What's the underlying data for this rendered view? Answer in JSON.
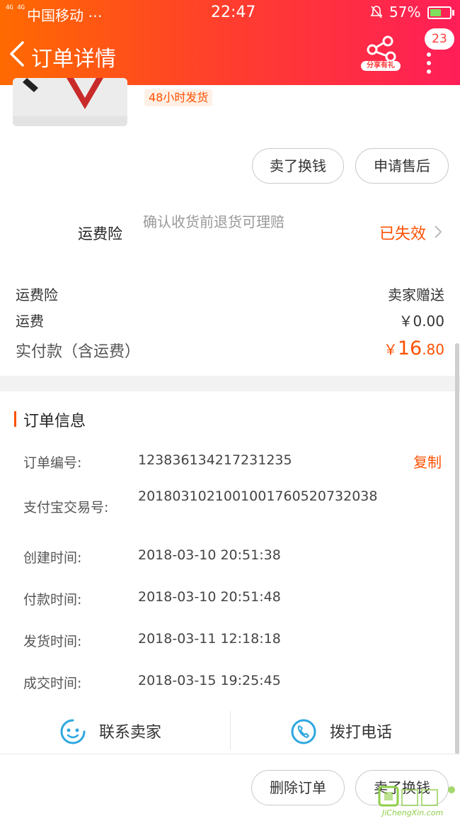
{
  "status_bar": {
    "network": "4G 4G",
    "carrier": "中国移动 ⋯",
    "time": "22:47",
    "battery": "57%",
    "battery_fill": 0.57
  },
  "header": {
    "title": "订单详情",
    "share_label": "分享有礼",
    "badge_count": "23"
  },
  "product": {
    "shipping_tag": "48小时发货"
  },
  "actions_top": {
    "sell_label": "卖了换钱",
    "after_sale_label": "申请售后"
  },
  "insurance": {
    "title": "运费险",
    "desc": "确认收货前退货可理赔",
    "status": "已失效"
  },
  "summary": {
    "rows": [
      {
        "label": "运费险",
        "value": "卖家赠送"
      },
      {
        "label": "运费",
        "value": "￥0.00"
      }
    ],
    "paid_label": "实付款（含运费）",
    "paid_currency": "￥",
    "paid_int": "16",
    "paid_dec": ".80"
  },
  "order_info": {
    "title": "订单信息",
    "copy_label": "复制",
    "rows": [
      {
        "label": "订单编号:",
        "value": "123836134217231235"
      },
      {
        "label": "支付宝交易号:",
        "value": "2018031021001001760520732038"
      },
      {
        "label": "创建时间:",
        "value": "2018-03-10 20:51:38"
      },
      {
        "label": "付款时间:",
        "value": "2018-03-10 20:51:48"
      },
      {
        "label": "发货时间:",
        "value": "2018-03-11 12:18:18"
      },
      {
        "label": "成交时间:",
        "value": "2018-03-15 19:25:45"
      }
    ]
  },
  "contact": {
    "seller_label": "联系卖家",
    "call_label": "拨打电话"
  },
  "actions_bottom": {
    "delete_label": "删除订单",
    "sell_label": "卖了换钱"
  },
  "watermark": {
    "text": "JiChengXin.com"
  },
  "colors": {
    "accent": "#ff5000",
    "header_start": "#ff6a00",
    "header_end": "#ff1e58",
    "icon_blue": "#2ea7e0"
  }
}
